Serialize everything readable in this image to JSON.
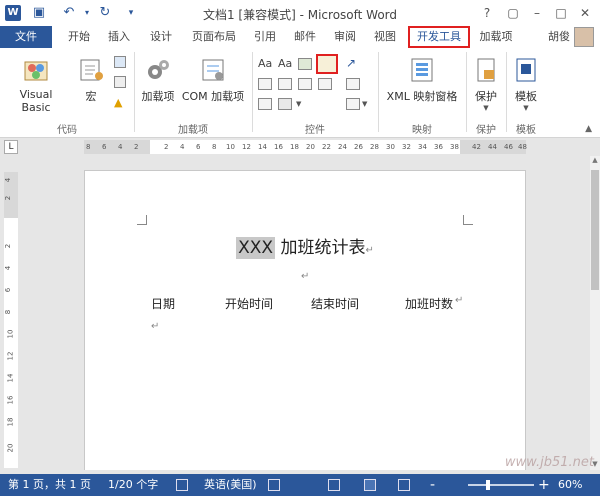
{
  "window": {
    "title": "文档1 [兼容模式] - Microsoft Word",
    "app_icon": "W",
    "controls": [
      "?",
      "▢",
      "–",
      "□",
      "✕"
    ]
  },
  "tabs": [
    "文件",
    "开始",
    "插入",
    "设计",
    "页面布局",
    "引用",
    "邮件",
    "审阅",
    "视图",
    "开发工具",
    "加载项"
  ],
  "user": {
    "name": "胡俊"
  },
  "ribbon": {
    "groups": {
      "code": "代码",
      "addins": "加载项",
      "controls": "控件",
      "mapping": "映射",
      "protect": "保护",
      "templates": "模板"
    },
    "buttons": {
      "visual_basic": "Visual Basic",
      "macros": "宏",
      "addins": "加载项",
      "com_addins": "COM 加载项",
      "xml_mapping": "XML 映射窗格",
      "protect": "保护",
      "template": "模板",
      "aa1": "Aa",
      "aa2": "Aa"
    }
  },
  "ruler": {
    "corner": "L",
    "h_ticks": [
      "8",
      "6",
      "4",
      "2",
      "2",
      "4",
      "6",
      "8",
      "10",
      "12",
      "14",
      "16",
      "18",
      "20",
      "22",
      "24",
      "26",
      "28",
      "30",
      "32",
      "34",
      "36",
      "38",
      "42",
      "44",
      "46",
      "48"
    ],
    "v_ticks": [
      "4",
      "2",
      "2",
      "4",
      "6",
      "8",
      "10",
      "12",
      "14",
      "16",
      "18",
      "20"
    ]
  },
  "document": {
    "title_highlight": "XXX",
    "title_rest": " 加班统计表",
    "columns": [
      "日期",
      "开始时间",
      "结束时间",
      "加班时数"
    ],
    "para_mark": "↵"
  },
  "status": {
    "page": "第 1 页，共 1 页",
    "words": "1/20 个字",
    "language": "英语(美国)",
    "zoom_minus": "-",
    "zoom_plus": "+",
    "zoom": "60%"
  },
  "watermark": "www.jb51.net",
  "colors": {
    "accent": "#2b579a",
    "highlight_box": "#e02020"
  }
}
